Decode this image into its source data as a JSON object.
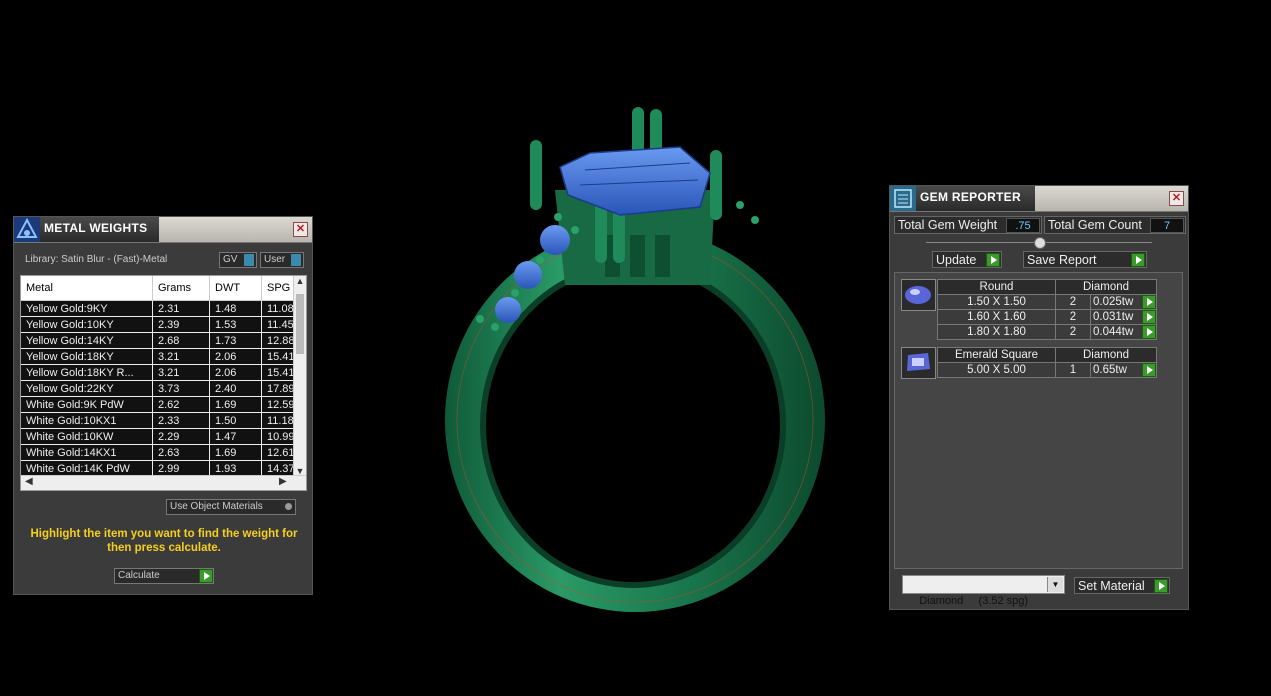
{
  "metal_weights": {
    "title": "METAL WEIGHTS",
    "library": "Library: Satin Blur - (Fast)-Metal",
    "gv_label": "GV",
    "user_label": "User",
    "columns": [
      "Metal",
      "Grams",
      "DWT",
      "SPG"
    ],
    "rows": [
      [
        "Yellow Gold:9KY",
        "2.31",
        "1.48",
        "11.08"
      ],
      [
        "Yellow Gold:10KY",
        "2.39",
        "1.53",
        "11.45"
      ],
      [
        "Yellow Gold:14KY",
        "2.68",
        "1.73",
        "12.88"
      ],
      [
        "Yellow Gold:18KY",
        "3.21",
        "2.06",
        "15.41"
      ],
      [
        "Yellow Gold:18KY R...",
        "3.21",
        "2.06",
        "15.41"
      ],
      [
        "Yellow Gold:22KY",
        "3.73",
        "2.40",
        "17.89"
      ],
      [
        "White Gold:9K PdW",
        "2.62",
        "1.69",
        "12.59"
      ],
      [
        "White Gold:10KX1",
        "2.33",
        "1.50",
        "11.18"
      ],
      [
        "White Gold:10KW",
        "2.29",
        "1.47",
        "10.99"
      ],
      [
        "White Gold:14KX1",
        "2.63",
        "1.69",
        "12.61"
      ],
      [
        "White Gold:14K PdW",
        "2.99",
        "1.93",
        "14.37"
      ]
    ],
    "use_object_materials": "Use Object Materials",
    "hint": "Highlight the item you want to find the weight for then press calculate.",
    "calculate_label": "Calculate"
  },
  "gem_reporter": {
    "title": "GEM REPORTER",
    "total_weight_label": "Total Gem Weight",
    "total_weight_value": ".75",
    "total_count_label": "Total Gem Count",
    "total_count_value": "7",
    "update_label": "Update",
    "save_label": "Save Report",
    "groups": [
      {
        "shape": "Round",
        "material": "Diamond",
        "icon": "round-gem-icon",
        "rows": [
          [
            "1.50 X 1.50",
            "2",
            "0.025tw"
          ],
          [
            "1.60 X 1.60",
            "2",
            "0.031tw"
          ],
          [
            "1.80 X 1.80",
            "2",
            "0.044tw"
          ]
        ]
      },
      {
        "shape": "Emerald Square",
        "material": "Diamond",
        "icon": "emerald-gem-icon",
        "rows": [
          [
            "5.00 X 5.00",
            "1",
            "0.65tw"
          ]
        ]
      }
    ],
    "material_select": "Diamond     (3.52 spg)",
    "set_material_label": "Set Material"
  },
  "colors": {
    "ring": "#1b7a4f",
    "gem": "#4a7fe0",
    "accent": "#f5d020"
  }
}
